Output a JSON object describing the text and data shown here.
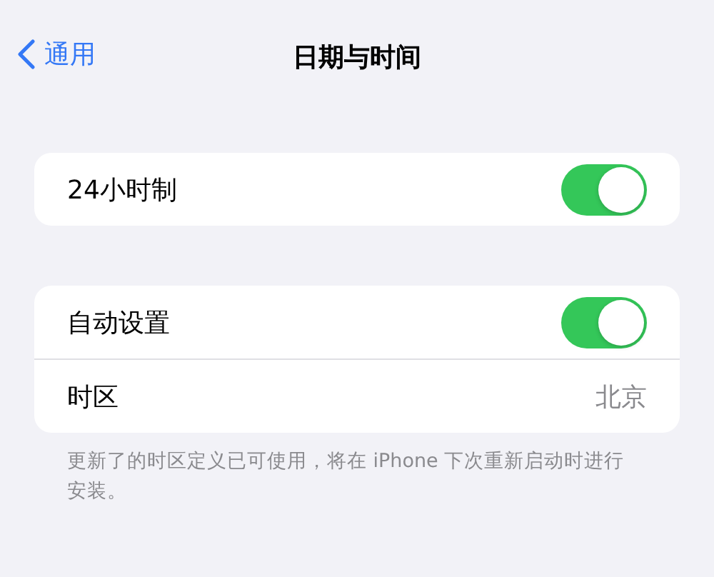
{
  "nav": {
    "back_label": "通用",
    "title": "日期与时间"
  },
  "sections": [
    {
      "rows": [
        {
          "kind": "toggle",
          "label": "24小时制",
          "on": true
        }
      ]
    },
    {
      "rows": [
        {
          "kind": "toggle",
          "label": "自动设置",
          "on": true
        },
        {
          "kind": "value",
          "label": "时区",
          "value": "北京"
        }
      ],
      "footer": "更新了的时区定义已可使用，将在 iPhone 下次重新启动时进行安装。"
    }
  ]
}
